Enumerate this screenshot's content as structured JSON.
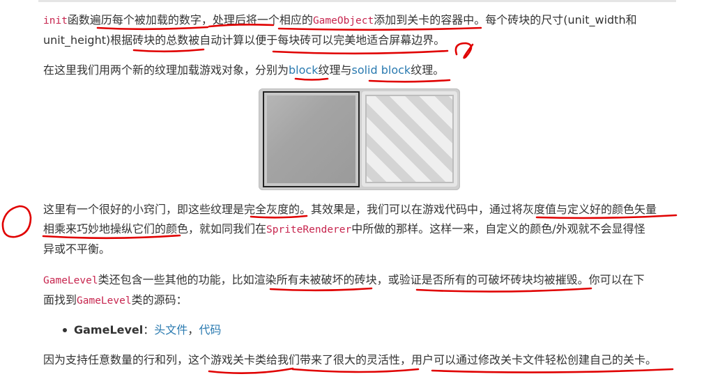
{
  "p1": {
    "code_init": "init",
    "t1": "函数遍历每个被加载的数字，处理后将一个相应的",
    "code_gameobject": "GameObject",
    "t2": "添加到关卡的容器中。每个砖块的尺寸(unit_width和",
    "line2": "unit_height)根据砖块的总数被自动计算以便于每块砖可以完美地适合屏幕边界。"
  },
  "p2": {
    "t1": "在这里我们用两个新的纹理加载游戏对象，分别为",
    "link_block": "block",
    "t2": "纹理与",
    "link_solid": "solid block",
    "t3": "纹理。"
  },
  "p3": {
    "line1": "这里有一个很好的小窍门，即这些纹理是完全灰度的。其效果是，我们可以在游戏代码中，通过将灰度值与定义好的颜色矢量",
    "t1": "相乘来巧妙地操纵它们的颜色，就如同我们在",
    "code_renderer": "SpriteRenderer",
    "t2": "中所做的那样。这样一来，自定义的颜色/外观就不会显得怪",
    "line3": "异或不平衡。"
  },
  "p4": {
    "code_gamelevel": "GameLevel",
    "t1": "类还包含一些其他的功能，比如渲染所有未被破坏的砖块，或验证是否所有的可破坏砖块均被摧毁。你可以在下",
    "t2": "面找到",
    "code_gamelevel2": "GameLevel",
    "t3": "类的源码："
  },
  "list": {
    "item_title": "GameLevel",
    "sep": "：",
    "link_header": "头文件",
    "comma": "，",
    "link_code": "代码"
  },
  "p5": {
    "line": "因为支持任意数量的行和列，这个游戏关卡类给我们带来了很大的灵活性，用户可以通过修改关卡文件轻松创建自己的关卡。"
  },
  "colors": {
    "text": "#333333",
    "code": "#c7254e",
    "link": "#2a7ab0",
    "annotation": "#e00000"
  }
}
